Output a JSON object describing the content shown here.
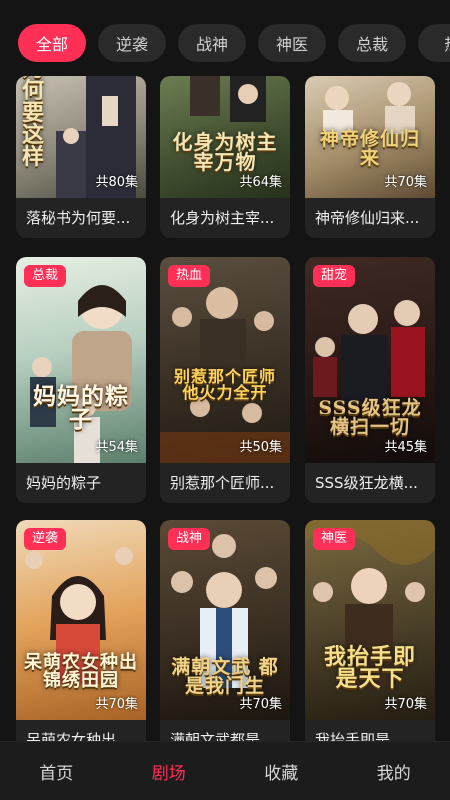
{
  "categories": [
    "全部",
    "逆袭",
    "战神",
    "神医",
    "总裁",
    "热"
  ],
  "active_category": "全部",
  "rows": [
    {
      "cards": [
        {
          "title_short": "落秘书为何要...",
          "episodes": "共80集",
          "poster_text": "为何要这样",
          "tag": ""
        },
        {
          "title_short": "化身为树主宰...",
          "episodes": "共64集",
          "poster_text": "化身为树主宰万物",
          "tag": ""
        },
        {
          "title_short": "神帝修仙归来...",
          "episodes": "共70集",
          "poster_text": "神帝修仙归来",
          "tag": ""
        }
      ]
    },
    {
      "cards": [
        {
          "title_short": "妈妈的粽子",
          "episodes": "共54集",
          "poster_text": "妈妈的粽子",
          "tag": "总裁"
        },
        {
          "title_short": "别惹那个匠师...",
          "episodes": "共50集",
          "poster_text": "别惹那个匠师 他火力全开",
          "tag": "热血"
        },
        {
          "title_short": "SSS级狂龙横...",
          "episodes": "共45集",
          "poster_text": "SSS级狂龙 横扫一切",
          "tag": "甜宠"
        }
      ]
    },
    {
      "cards": [
        {
          "title_short": "呆萌农女种出...",
          "episodes": "共70集",
          "poster_text": "呆萌农女种出 锦绣田园",
          "tag": "逆袭"
        },
        {
          "title_short": "满朝文武都是...",
          "episodes": "共70集",
          "poster_text": "满朝文武 都是我门生",
          "tag": "战神"
        },
        {
          "title_short": "我抬手即是...",
          "episodes": "共70集",
          "poster_text": "我抬手即 是天下",
          "tag": "神医"
        }
      ]
    }
  ],
  "nav": {
    "items": [
      "首页",
      "剧场",
      "收藏",
      "我的"
    ],
    "active": "剧场"
  }
}
